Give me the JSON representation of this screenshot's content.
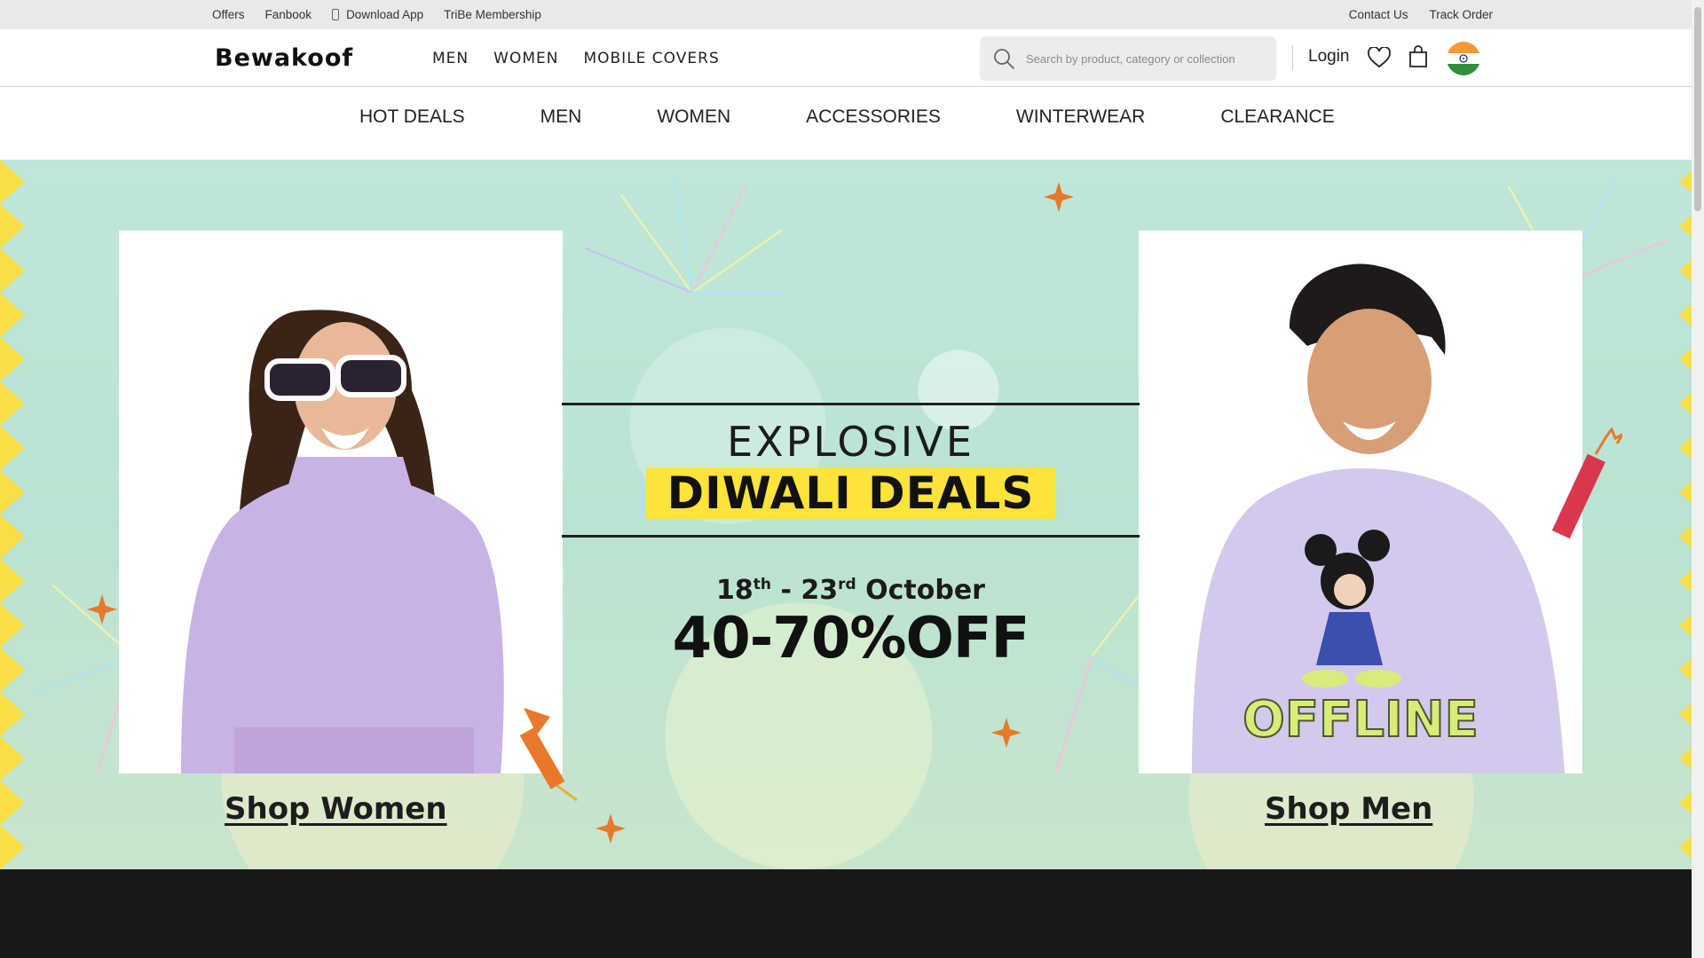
{
  "utility_bar": {
    "left_items": [
      "Offers",
      "Fanbook",
      "Download App",
      "TriBe Membership"
    ],
    "right_items": [
      "Contact Us",
      "Track Order"
    ]
  },
  "header": {
    "logo": "Bewakoof",
    "nav": [
      "MEN",
      "WOMEN",
      "MOBILE COVERS"
    ],
    "search_placeholder": "Search by product, category or collection",
    "login_label": "Login",
    "icons": [
      "search-icon",
      "wishlist-heart-icon",
      "shopping-bag-icon",
      "india-flag-icon"
    ]
  },
  "category_nav": [
    "HOT DEALS",
    "MEN",
    "WOMEN",
    "ACCESSORIES",
    "WINTERWEAR",
    "CLEARANCE"
  ],
  "banner": {
    "line1": "EXPLOSIVE",
    "line2": "DIWALI DEALS",
    "date_start": "18",
    "date_start_suffix": "th",
    "date_sep": " - ",
    "date_end": "23",
    "date_end_suffix": "rd",
    "date_month": " October",
    "discount": "40-70%OFF",
    "shop_women": "Shop Women",
    "shop_men": "Shop Men",
    "tshirt_print": "OFFLINE",
    "colors": {
      "background": "#bfe7d8",
      "highlight": "#fde33a",
      "sweater": "#c9b3e6",
      "accent": "#e8782a"
    }
  }
}
